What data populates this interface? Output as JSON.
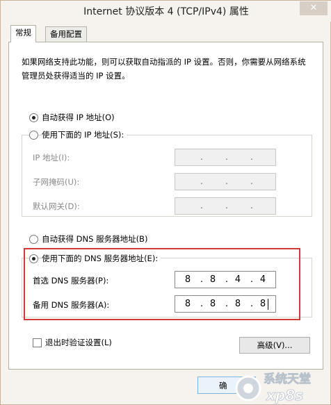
{
  "window": {
    "title": "Internet 协议版本 4 (TCP/IPv4) 属性",
    "close_glyph": "✕"
  },
  "tabs": [
    {
      "label": "常规",
      "active": true
    },
    {
      "label": "备用配置",
      "active": false
    }
  ],
  "description": "如果网络支持此功能，则可以获取自动指派的 IP 设置。否则，你需要从网络系统管理员处获得适当的 IP 设置。",
  "ip_section": {
    "auto_label": "自动获得 IP 地址(O)",
    "auto_checked": true,
    "manual_label": "使用下面的 IP 地址(S):",
    "manual_checked": false,
    "fields": [
      {
        "label": "IP 地址(I):",
        "octets": [
          "",
          "",
          "",
          ""
        ]
      },
      {
        "label": "子网掩码(U):",
        "octets": [
          "",
          "",
          "",
          ""
        ]
      },
      {
        "label": "默认网关(D):",
        "octets": [
          "",
          "",
          "",
          ""
        ]
      }
    ]
  },
  "dns_section": {
    "auto_label": "自动获得 DNS 服务器地址(B)",
    "auto_checked": false,
    "manual_label": "使用下面的 DNS 服务器地址(E):",
    "manual_checked": true,
    "preferred": {
      "label": "首选 DNS 服务器(P):",
      "octets": [
        "8",
        "8",
        "4",
        "4"
      ]
    },
    "alternate": {
      "label": "备用 DNS 服务器(A):",
      "octets": [
        "8",
        "8",
        "8",
        "8"
      ]
    }
  },
  "validate_label": "退出时验证设置(L)",
  "validate_checked": false,
  "advanced_button": "高级(V)...",
  "ok_button_partial": "确",
  "watermark_text": "系统天堂",
  "watermark_sub": "xp8s"
}
